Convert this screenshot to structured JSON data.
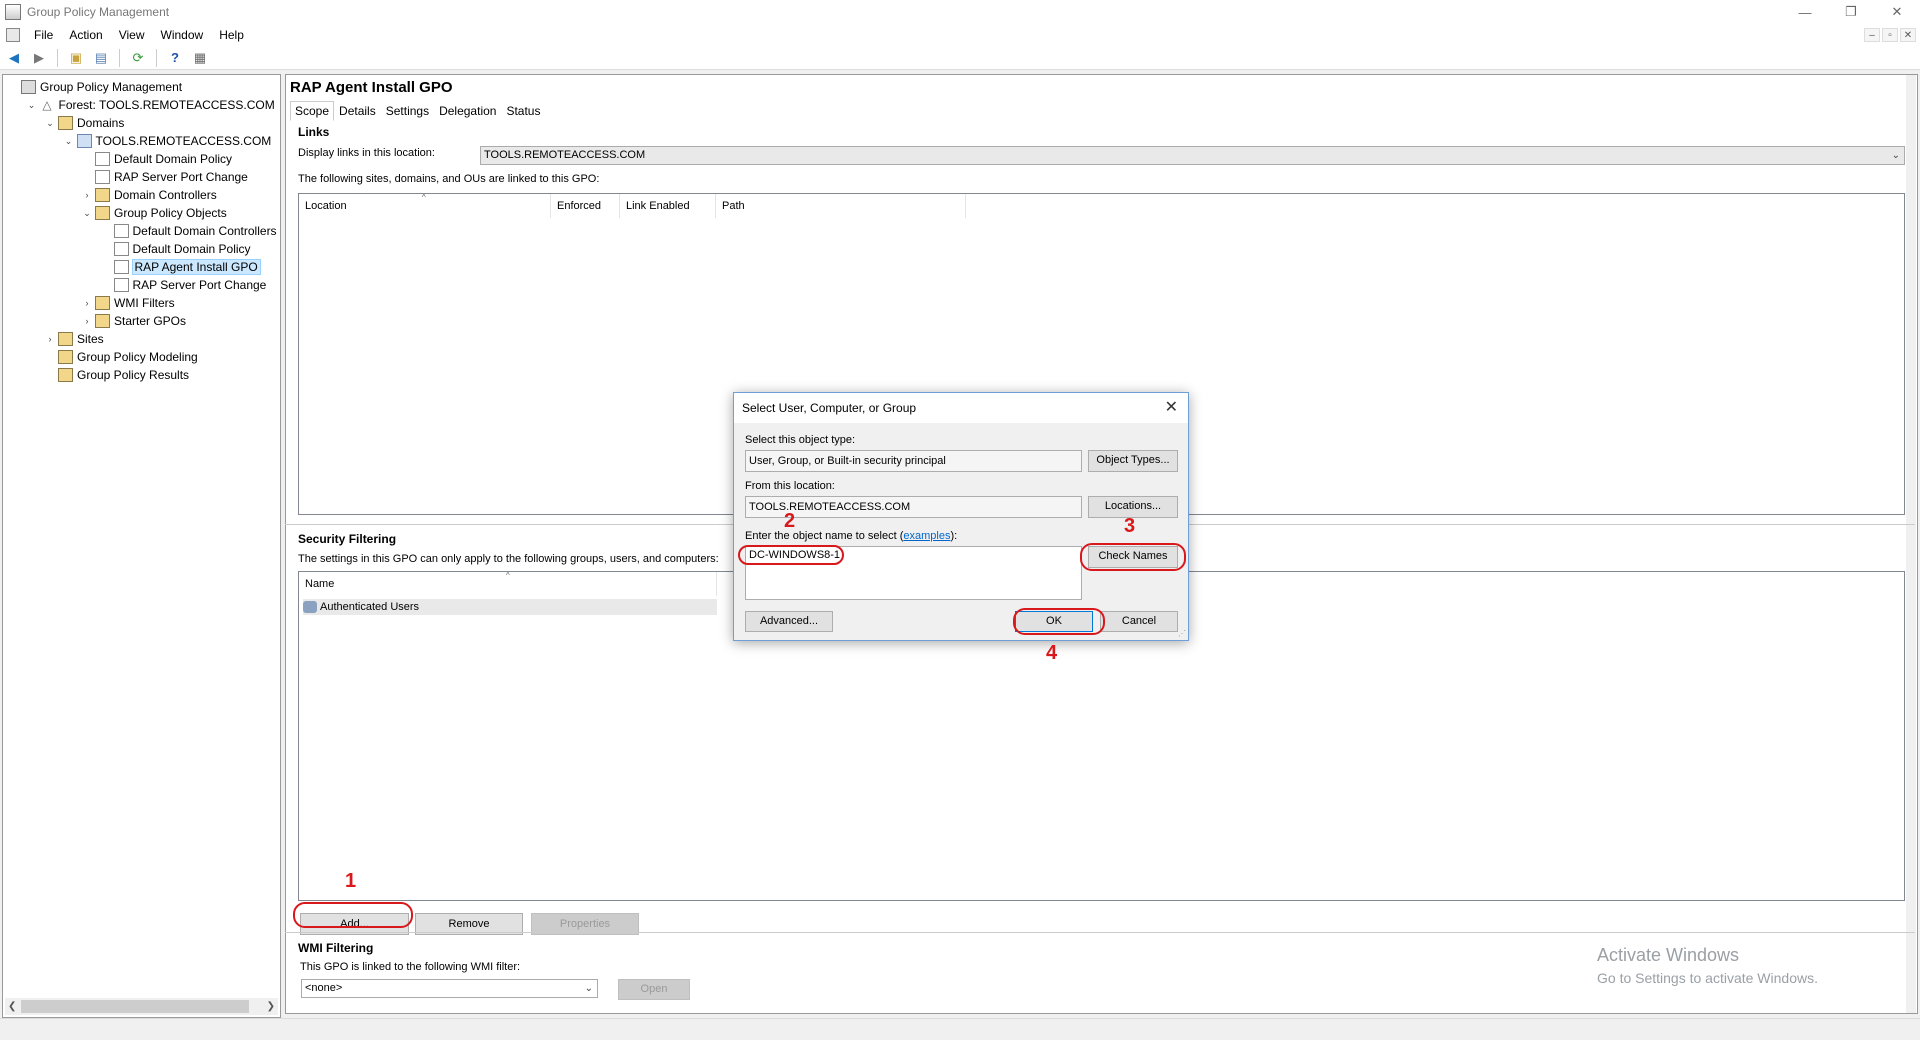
{
  "window": {
    "title": "Group Policy Management",
    "min": "—",
    "restore": "❐",
    "close": "✕"
  },
  "menu": [
    "File",
    "Action",
    "View",
    "Window",
    "Help"
  ],
  "child_controls": [
    "–",
    "▫",
    "✕"
  ],
  "tree": [
    {
      "label": "Group Policy Management",
      "indent": 0,
      "exp": "",
      "icon": "root"
    },
    {
      "label": "Forest: TOOLS.REMOTEACCESS.COM",
      "indent": 1,
      "exp": "⌄",
      "icon": "forest"
    },
    {
      "label": "Domains",
      "indent": 2,
      "exp": "⌄",
      "icon": "folder"
    },
    {
      "label": "TOOLS.REMOTEACCESS.COM",
      "indent": 3,
      "exp": "⌄",
      "icon": "domain"
    },
    {
      "label": "Default Domain Policy",
      "indent": 4,
      "exp": "",
      "icon": "gpo"
    },
    {
      "label": "RAP Server Port Change",
      "indent": 4,
      "exp": "",
      "icon": "gpo"
    },
    {
      "label": "Domain Controllers",
      "indent": 4,
      "exp": "›",
      "icon": "folder"
    },
    {
      "label": "Group Policy Objects",
      "indent": 4,
      "exp": "⌄",
      "icon": "folder"
    },
    {
      "label": "Default Domain Controllers Po",
      "indent": 5,
      "exp": "",
      "icon": "gpo"
    },
    {
      "label": "Default Domain Policy",
      "indent": 5,
      "exp": "",
      "icon": "gpo"
    },
    {
      "label": "RAP Agent Install GPO",
      "indent": 5,
      "exp": "",
      "icon": "gpo",
      "selected": true
    },
    {
      "label": "RAP Server Port Change",
      "indent": 5,
      "exp": "",
      "icon": "gpo"
    },
    {
      "label": "WMI Filters",
      "indent": 4,
      "exp": "›",
      "icon": "folder"
    },
    {
      "label": "Starter GPOs",
      "indent": 4,
      "exp": "›",
      "icon": "folder"
    },
    {
      "label": "Sites",
      "indent": 2,
      "exp": "›",
      "icon": "folder"
    },
    {
      "label": "Group Policy Modeling",
      "indent": 2,
      "exp": "",
      "icon": "folder"
    },
    {
      "label": "Group Policy Results",
      "indent": 2,
      "exp": "",
      "icon": "folder"
    }
  ],
  "gpo": {
    "title": "RAP Agent Install GPO",
    "tabs": [
      "Scope",
      "Details",
      "Settings",
      "Delegation",
      "Status"
    ],
    "links": {
      "heading": "Links",
      "display_label": "Display links in this location:",
      "location_value": "TOOLS.REMOTEACCESS.COM",
      "desc": "The following sites, domains, and OUs are linked to this GPO:",
      "columns": [
        "Location",
        "Enforced",
        "Link Enabled",
        "Path"
      ]
    },
    "security": {
      "heading": "Security Filtering",
      "desc": "The settings in this GPO can only apply to the following groups, users, and computers:",
      "column": "Name",
      "rows": [
        "Authenticated Users"
      ],
      "add": "Add...",
      "remove": "Remove",
      "properties": "Properties"
    },
    "wmi": {
      "heading": "WMI Filtering",
      "desc": "This GPO is linked to the following WMI filter:",
      "value": "<none>",
      "open": "Open"
    }
  },
  "dialog": {
    "title": "Select User, Computer, or Group",
    "object_type_label": "Select this object type:",
    "object_type_value": "User, Group, or Built-in security principal",
    "object_types_btn": "Object Types...",
    "location_label": "From this location:",
    "location_value": "TOOLS.REMOTEACCESS.COM",
    "locations_btn": "Locations...",
    "enter_label_pre": "Enter the object name to select (",
    "examples_link": "examples",
    "enter_label_post": "):",
    "object_name_value": "DC-WINDOWS8-1",
    "check_names_btn": "Check Names",
    "advanced_btn": "Advanced...",
    "ok_btn": "OK",
    "cancel_btn": "Cancel"
  },
  "annotations": [
    "1",
    "2",
    "3",
    "4"
  ],
  "activate": {
    "line1": "Activate Windows",
    "line2": "Go to Settings to activate Windows."
  },
  "colors": {
    "annotation": "#d8181b",
    "selection": "#cce8ff",
    "link": "#0066cc"
  }
}
